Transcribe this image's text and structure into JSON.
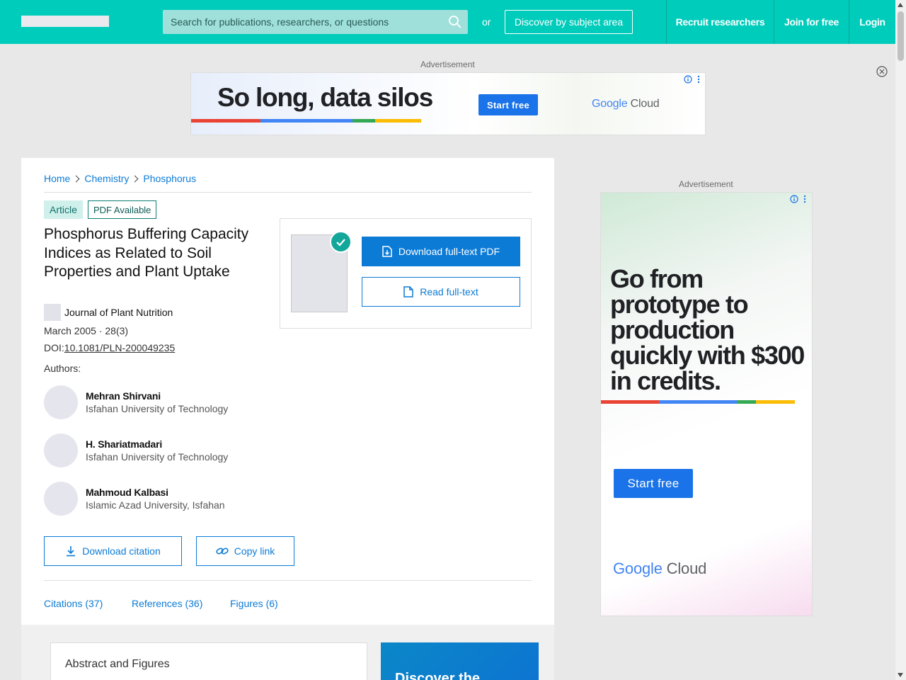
{
  "header": {
    "search_placeholder": "Search for publications, researchers, or questions",
    "or_label": "or",
    "discover_label": "Discover by subject area",
    "nav": [
      "Recruit researchers",
      "Join for free",
      "Login"
    ]
  },
  "ads": {
    "label": "Advertisement",
    "top": {
      "headline": "So long, data silos",
      "cta": "Start free",
      "brand_google": "Google",
      "brand_cloud": "Cloud"
    },
    "side": {
      "headline": "Go from prototype to production quickly with $300 in credits.",
      "cta": "Start free",
      "brand_google": "Google",
      "brand_cloud": "Cloud"
    },
    "brand_colors": [
      "#ea4335",
      "#4285f4",
      "#34a853",
      "#fbbc05"
    ]
  },
  "breadcrumb": [
    "Home",
    "Chemistry",
    "Phosphorus"
  ],
  "article": {
    "type_badge": "Article",
    "pdf_badge": "PDF Available",
    "title": "Phosphorus Buffering Capacity Indices as Related to Soil Properties and Plant Uptake",
    "journal": "Journal of Plant Nutrition",
    "date": "March 2005 · 28(3)",
    "doi_prefix": "DOI:",
    "doi": "10.1081/PLN-200049235",
    "authors_label": "Authors:",
    "authors": [
      {
        "name": "Mehran Shirvani",
        "institution": "Isfahan University of Technology"
      },
      {
        "name": "H. Shariatmadari",
        "institution": "Isfahan University of Technology"
      },
      {
        "name": "Mahmoud Kalbasi",
        "institution": "Islamic Azad University, Isfahan"
      }
    ]
  },
  "actions": {
    "download_pdf": "Download full-text PDF",
    "read_fulltext": "Read full-text",
    "download_citation": "Download citation",
    "copy_link": "Copy link"
  },
  "tabs": [
    "Citations (37)",
    "References (36)",
    "Figures (6)"
  ],
  "abstract_title": "Abstract and Figures",
  "promo_text": "Discover the",
  "colors": {
    "brand_teal": "#00ccbb",
    "link_blue": "#0c7bd6",
    "ad_blue": "#1a73e8"
  }
}
